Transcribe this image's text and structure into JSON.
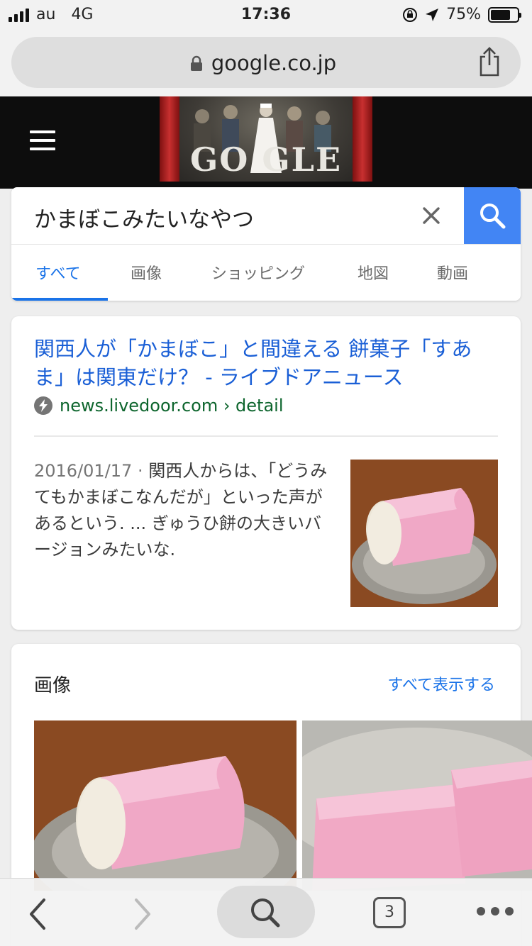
{
  "status_bar": {
    "carrier": "au",
    "network": "4G",
    "time": "17:36",
    "battery": "75%",
    "battery_level": 0.75
  },
  "browser": {
    "url": "google.co.jp",
    "open_tabs": "3"
  },
  "google": {
    "doodle_text": "GO GLE"
  },
  "search": {
    "query": "かまぼこみたいなやつ",
    "tabs": [
      "すべて",
      "画像",
      "ショッピング",
      "地図",
      "動画"
    ],
    "active_tab": "すべて"
  },
  "result": {
    "title": "関西人が「かまぼこ」と間違える 餅菓子「すあま」は関東だけ？ - ライブドアニュース",
    "site": "news.livedoor.com",
    "path": " › detail",
    "date": "2016/01/17",
    "separator": " · ",
    "snippet": "関西人からは、「どうみてもかまぼこなんだが」といった声があるという. ... ぎゅうひ餅の大きいバージョンみたいな."
  },
  "images_section": {
    "heading": "画像",
    "show_all": "すべて表示する"
  },
  "colors": {
    "link_blue": "#1a5fd6",
    "accent_blue": "#4285f4",
    "url_green": "#0d652d",
    "header_black": "#0d0d0d"
  },
  "icons": {
    "lock": "lock-icon",
    "share": "share-icon",
    "menu": "hamburger-menu-icon",
    "clear": "close-icon",
    "search": "search-icon",
    "amp": "lightning-bolt-icon",
    "back": "chevron-left-icon",
    "forward": "chevron-right-icon",
    "more": "more-dots-icon"
  }
}
